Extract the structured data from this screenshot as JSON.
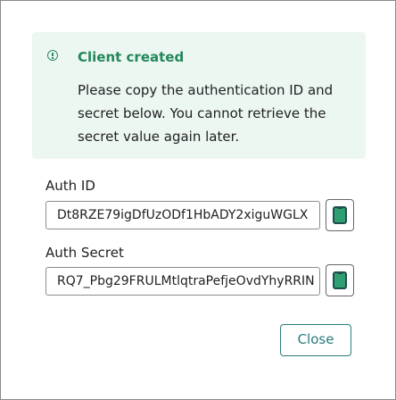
{
  "alert": {
    "title": "Client created",
    "body": "Please copy the authentication ID and secret below. You cannot retrieve the secret value again later."
  },
  "auth_id": {
    "label": "Auth ID",
    "value": "Dt8RZE79igDfUzODf1HbADY2xiguWGLX"
  },
  "auth_secret": {
    "label": "Auth Secret",
    "value": "RQ7_Pbg29FRULMtlqtraPefjeOvdYhyRRIN"
  },
  "actions": {
    "close_label": "Close"
  },
  "icons": {
    "alert": "info-circle-icon",
    "copy": "clipboard-icon"
  },
  "colors": {
    "success": "#22875a",
    "alert_bg": "#edf7f2",
    "accent": "#2a7c7c"
  }
}
